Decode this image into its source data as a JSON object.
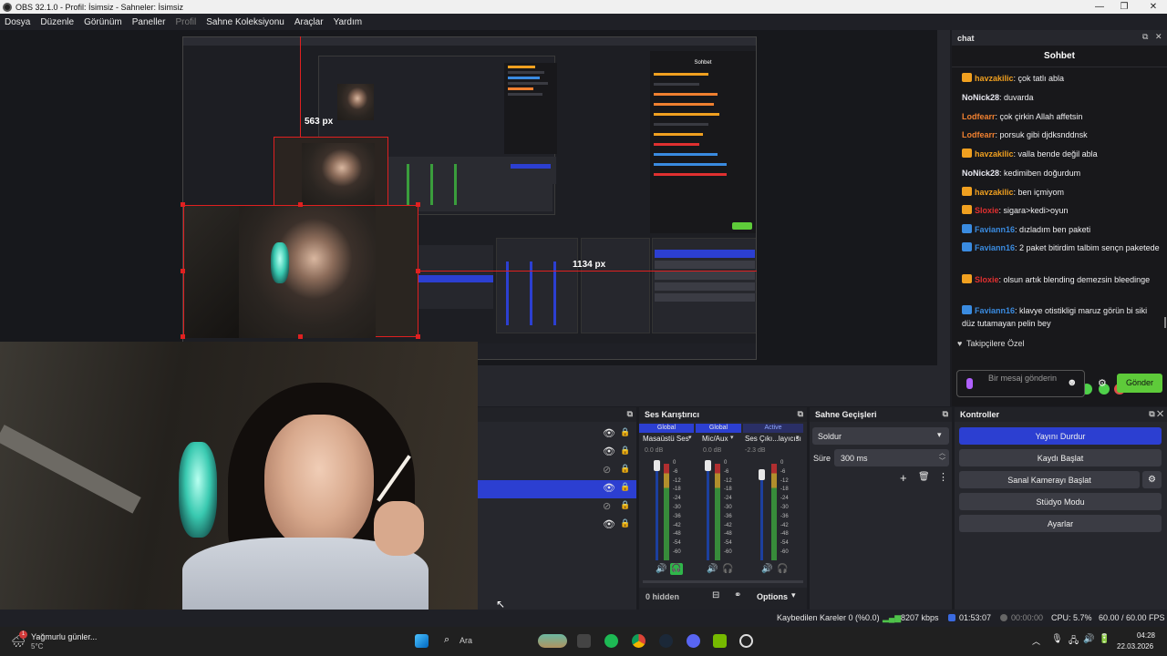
{
  "window": {
    "title": "OBS 32.1.0 - Profil: İsimsiz - Sahneler: İsimsiz"
  },
  "menu": [
    {
      "label": "Dosya",
      "disabled": false
    },
    {
      "label": "Düzenle",
      "disabled": false
    },
    {
      "label": "Görünüm",
      "disabled": false
    },
    {
      "label": "Paneller",
      "disabled": false
    },
    {
      "label": "Profil",
      "disabled": true
    },
    {
      "label": "Sahne Koleksiyonu",
      "disabled": false
    },
    {
      "label": "Araçlar",
      "disabled": false
    },
    {
      "label": "Yardım",
      "disabled": false
    }
  ],
  "preview": {
    "labels": {
      "width_563": "563 px",
      "width_1134": "1134 px"
    }
  },
  "chat": {
    "dock_title": "chat",
    "header": "Sohbet",
    "messages": [
      {
        "user": "havzakilic",
        "text": ": çok tatlı abla",
        "color": "#f0a020",
        "badge": "gold"
      },
      {
        "user": "NoNick28",
        "text": ": duvarda",
        "color": "#e8e8f0",
        "badge": ""
      },
      {
        "user": "Lodfearr",
        "text": ": çok çirkin Allah affetsin",
        "color": "#f08030",
        "badge": ""
      },
      {
        "user": "Lodfearr",
        "text": ": porsuk gibi djdksnddnsk",
        "color": "#f08030",
        "badge": ""
      },
      {
        "user": "havzakilic",
        "text": ": valla bende değil abla",
        "color": "#f0a020",
        "badge": "gold"
      },
      {
        "user": "NoNick28",
        "text": ": kedimiben doğurdum",
        "color": "#e8e8f0",
        "badge": ""
      },
      {
        "user": "havzakilic",
        "text": ": ben içmiyom",
        "color": "#f0a020",
        "badge": "gold"
      },
      {
        "user": "Sloxie",
        "text": ": sigara>kedi>oyun",
        "color": "#e03030",
        "badge": "gold"
      },
      {
        "user": "Faviann16",
        "text": ": dızladım ben paketi",
        "color": "#3a8be0",
        "badge": "blue"
      },
      {
        "user": "Faviann16",
        "text": ": 2 paket bitirdim talbim sençn paketede",
        "color": "#3a8be0",
        "badge": "blue"
      },
      {
        "user": "Sloxie",
        "text": ": olsun artık blending demezsin bleedinge",
        "color": "#e03030",
        "badge": "gold"
      },
      {
        "user": "Faviann16",
        "text": ": klavye otistikligi maruz görün bi siki düz tutamayan pelin bey",
        "color": "#3a8be0",
        "badge": "blue"
      }
    ],
    "follower_label": "Takipçilere Özel",
    "input_placeholder": "Bir mesaj gönderin",
    "send_label": "Gönder"
  },
  "audio_mixer": {
    "title": "Ses Karıştırıcı",
    "channels": [
      {
        "scope": "Global",
        "name": "Masaüstü Ses",
        "db": "0.0 dB"
      },
      {
        "scope": "Global",
        "name": "Mic/Aux",
        "db": "0.0 dB"
      },
      {
        "scope": "Active",
        "name": "Ses Çıkı...layıcısı",
        "db": "-2.3 dB"
      }
    ],
    "scale": [
      "0",
      "-6",
      "-12",
      "-18",
      "-24",
      "-30",
      "-36",
      "-42",
      "-48",
      "-54",
      "-60"
    ],
    "hidden_label": "0 hidden",
    "options_label": "Options"
  },
  "transitions": {
    "title": "Sahne Geçişleri",
    "selected": "Soldur",
    "duration_label": "Süre",
    "duration_value": "300 ms"
  },
  "controls": {
    "title": "Kontroller",
    "buttons": [
      "Yayını Durdur",
      "Kaydı Başlat",
      "Sanal Kamerayı Başlat",
      "Stüdyo Modu",
      "Ayarlar"
    ]
  },
  "status": {
    "dropped_frames": "Kaybedilen Kareler 0 (%0.0)",
    "bitrate": "8207 kbps",
    "stream_time": "01:53:07",
    "record_time": "00:00:00",
    "cpu": "CPU: 5.7%",
    "fps": "60.00 / 60.00 FPS"
  },
  "taskbar": {
    "weather_title": "Yağmurlu günler...",
    "weather_temp": "5°C",
    "search_placeholder": "Ara",
    "time": "04:28",
    "date": "22.03.2026",
    "notification_count": "1"
  },
  "colors": {
    "accent": "#2c3fd1",
    "send_button": "#5ecb3a",
    "selection_red": "#e02020"
  }
}
